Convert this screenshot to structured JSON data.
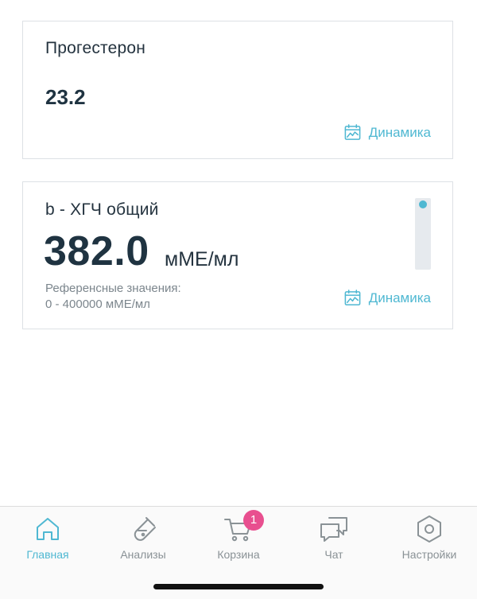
{
  "cards": [
    {
      "title": "Прогестерон",
      "value": "23.2",
      "dynamics_label": "Динамика"
    },
    {
      "title": "b - ХГЧ общий",
      "value": "382.0",
      "unit": "мМЕ/мл",
      "reference_label": "Референсные значения:",
      "reference_range": "0 - 400000 мМЕ/мл",
      "dynamics_label": "Динамика",
      "scale_level": 0.0
    }
  ],
  "tabbar": {
    "tabs": [
      {
        "label": "Главная",
        "icon": "home-icon",
        "active": true
      },
      {
        "label": "Анализы",
        "icon": "test-tube-icon",
        "active": false
      },
      {
        "label": "Корзина",
        "icon": "cart-icon",
        "active": false,
        "badge": "1"
      },
      {
        "label": "Чат",
        "icon": "chat-icon",
        "active": false
      },
      {
        "label": "Настройки",
        "icon": "settings-icon",
        "active": false
      }
    ]
  },
  "colors": {
    "accent": "#4fb8d2",
    "badge": "#e84f8f",
    "text_dark": "#1f3341",
    "text_muted": "#7c868d"
  }
}
